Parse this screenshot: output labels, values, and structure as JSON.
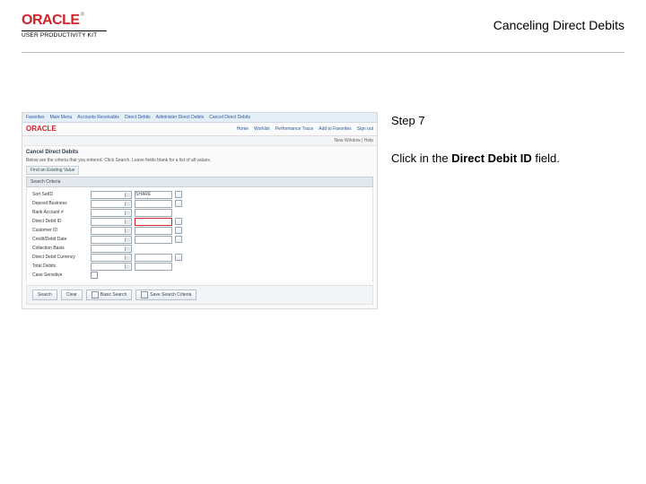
{
  "header": {
    "logo_text": "ORACLE",
    "logo_tm": "®",
    "logo_sub": "USER PRODUCTIVITY KIT",
    "title": "Canceling Direct Debits"
  },
  "sidebar": {
    "step_label": "Step 7",
    "instruction_pre": "Click in the ",
    "instruction_bold": "Direct Debit ID",
    "instruction_post": " field."
  },
  "shot": {
    "nav": [
      "Favorites",
      "Main Menu",
      "Accounts Receivable",
      "Direct Debits",
      "Administer Direct Debits",
      "Cancel Direct Debits"
    ],
    "brand": "ORACLE",
    "brand_links": [
      "Home",
      "Worklist",
      "Performance Trace",
      "Add to Favorites",
      "Sign out"
    ],
    "util": "New Window | Help",
    "page_title": "Cancel Direct Debits",
    "page_sub": "Below are the criteria that you entered. Click Search. Leave fields blank for a list of all values.",
    "tab": "Find an Existing Value",
    "panel": "Search Criteria",
    "rows": [
      {
        "label": "Sort  SetID",
        "mode": "sel_text",
        "sel": "=",
        "val": "SHARE",
        "lookup": true,
        "highlight": false
      },
      {
        "label": "Deposit Business",
        "mode": "sel_text",
        "val": "",
        "lookup": true,
        "highlight": false
      },
      {
        "label": "Bank Account #",
        "mode": "sel_val",
        "val": "",
        "lookup": false,
        "highlight": false
      },
      {
        "label": "Direct Debit ID",
        "mode": "sel_val",
        "val": "",
        "lookup": true,
        "highlight": true
      },
      {
        "label": "Customer ID",
        "mode": "sel_val",
        "val": "",
        "lookup": true,
        "highlight": false
      },
      {
        "label": "Credit/Debit Date",
        "mode": "sel_val",
        "val": "",
        "lookup": true,
        "highlight": false
      },
      {
        "label": "Collection Basis",
        "mode": "sel_only",
        "lookup": false,
        "highlight": false
      },
      {
        "label": "Direct Debit Currency",
        "mode": "sel_val",
        "val": "",
        "lookup": true,
        "highlight": false
      },
      {
        "label": "Total Debits",
        "mode": "sel_val",
        "val": "",
        "lookup": false,
        "highlight": false
      },
      {
        "label": "Case Sensitive",
        "mode": "check",
        "lookup": false,
        "highlight": false
      }
    ],
    "buttons": [
      "Search",
      "Clear",
      "Basic Search",
      "Save Search Criteria"
    ]
  }
}
